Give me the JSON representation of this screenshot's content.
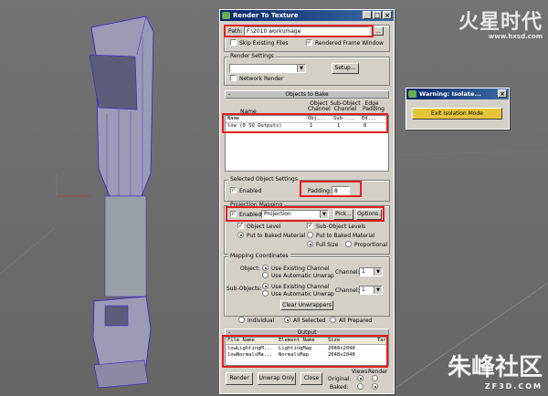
{
  "watermark_top": {
    "big": "火星时代",
    "small": "www.hxsd.com"
  },
  "watermark_bottom": {
    "big": "朱峰社区",
    "small": "ZF3D.COM"
  },
  "dialog": {
    "title": "Render To Texture",
    "path_label": "Path:",
    "path_value": "F:\\2010 work\\image",
    "path_browse": "...",
    "skip_existing": "Skip Existing Files",
    "rendered_frame_window": "Rendered Frame Window",
    "render_settings_label": "Render Settings",
    "setup_button": "Setup...",
    "network_render": "Network Render",
    "objects_to_bake": "Objects to Bake",
    "columns": {
      "name": "Name",
      "obj_channel": "Object Channel",
      "subobj_channel": "Sub-Object Channel",
      "edge_padding": "Edge Padding"
    },
    "bake_rows": [
      {
        "name": "Name",
        "obj": "Obj...",
        "sub": "Sub-...",
        "edge": "Ed..."
      },
      {
        "name": "low (0 SO Outputs)",
        "obj": "1",
        "sub": "1",
        "edge": "8"
      }
    ],
    "selected_object_settings": "Selected Object Settings",
    "enabled": "Enabled",
    "padding_label": "Padding:",
    "padding_value": "8",
    "projection_mapping": "Projection Mapping",
    "projection_enabled": "Enabled",
    "projection_value": "Projection",
    "pick_button": "Pick...",
    "options_button": "Options...",
    "object_level": "Object Level",
    "subobject_levels": "Sub-Object Levels",
    "put_to_baked_material": "Put to Baked Material",
    "put_to_baked_material_2": "Put to Baked Material",
    "full_size": "Full Size",
    "proportional": "Proportional",
    "mapping_coordinates": "Mapping Coordinates",
    "object_label": "Object:",
    "use_existing_channel": "Use Existing Channel",
    "use_automatic_unwrap": "Use Automatic Unwrap",
    "channel_label": "Channel:",
    "channel_value": "1",
    "subobjects_label": "Sub-Objects:",
    "use_existing_channel_2": "Use Existing Channel",
    "use_automatic_unwrap_2": "Use Automatic Unwrap",
    "channel_label_2": "Channel:",
    "channel_value_2": "1",
    "clear_unwrappers": "Clear Unwrappers",
    "individual": "Individual",
    "all_selected": "All Selected",
    "all_prepared": "All Prepared",
    "output": "Output",
    "output_columns": {
      "file_name": "File Name",
      "element_name": "Element Name",
      "size": "Size",
      "tar": "Tar"
    },
    "output_rows": [
      {
        "file": "lowLightingM...",
        "element": "LightingMap",
        "size": "2048x2048"
      },
      {
        "file": "lowNormalsMa...",
        "element": "NormalsMap",
        "size": "2048x2048"
      }
    ],
    "render_button": "Render",
    "unwrap_only_button": "Unwrap Only",
    "close_button": "Close",
    "views_label": "Views",
    "render_label": "Render",
    "original_label": "Original:",
    "baked_label": "Baked:"
  },
  "warning": {
    "title": "Warning: Isolate...",
    "button": "Exit Isolation Mode"
  }
}
